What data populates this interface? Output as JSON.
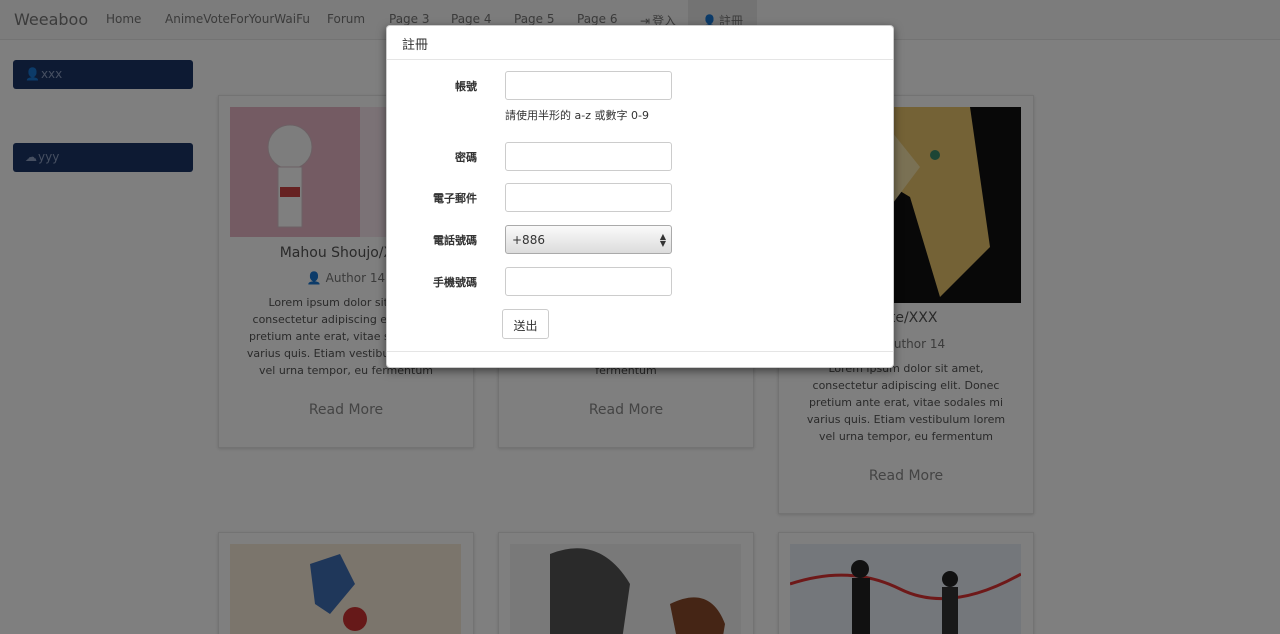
{
  "navbar": {
    "brand": "Weeaboo",
    "links": [
      "Home",
      "AnimeVoteForYourWaiFu",
      "Forum",
      "Page 3",
      "Page 4",
      "Page 5",
      "Page 6"
    ],
    "login_label": "登入",
    "register_label": "註冊"
  },
  "sidebar": {
    "items": [
      {
        "label": "xxx",
        "icon": "user-icon"
      },
      {
        "label": "yyy",
        "icon": "cloud-icon"
      }
    ]
  },
  "cards": [
    {
      "title": "Mahou Shoujo/XXX",
      "author": "Author 14",
      "text": "Lorem ipsum dolor sit amet, consectetur adipiscing elit. Donec pretium ante erat, vitae sodales mi varius quis. Etiam vestibulum lorem vel urna tempor, eu fermentum",
      "more": "Read More"
    },
    {
      "title": "",
      "author": "",
      "text": "fermentum",
      "more": "Read More"
    },
    {
      "title": "Fate/XXX",
      "author": "Author 14",
      "text": "Lorem ipsum dolor sit amet, consectetur adipiscing elit. Donec pretium ante erat, vitae sodales mi varius quis. Etiam vestibulum lorem vel urna tempor, eu fermentum",
      "more": "Read More"
    }
  ],
  "modal": {
    "title": "註冊",
    "fields": {
      "account_label": "帳號",
      "account_help": "請使用半形的 a-z 或數字 0-9",
      "password_label": "密碼",
      "email_label": "電子郵件",
      "phone_label": "電話號碼",
      "phone_code": "+886",
      "mobile_label": "手機號碼"
    },
    "submit_label": "送出"
  },
  "colors": {
    "sidebar_button": "#1a3567",
    "backdrop": "rgba(0,0,0,0.5)"
  }
}
